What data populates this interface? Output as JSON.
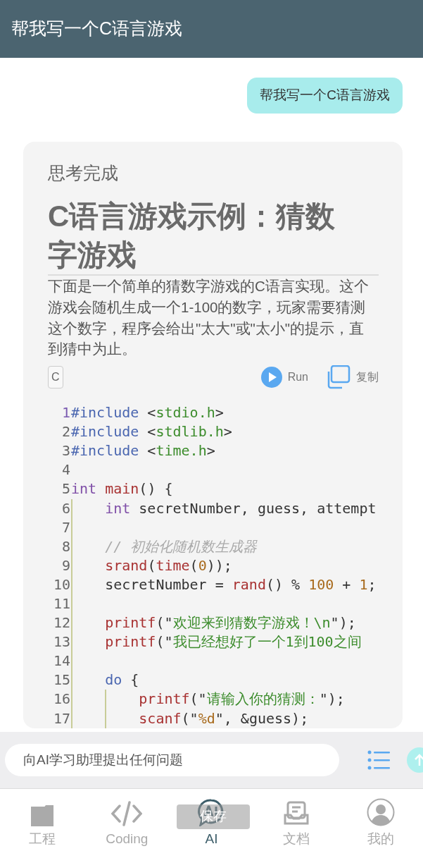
{
  "header": {
    "title": "帮我写一个C语言游戏"
  },
  "user_message": "帮我写一个C语言游戏",
  "answer": {
    "status": "思考完成",
    "heading": "C语言游戏示例：猜数字游戏",
    "paragraph": "下面是一个简单的猜数字游戏的C语言实现。这个游戏会随机生成一个1-100的数字，玩家需要猜测这个数字，程序会给出\"太大\"或\"太小\"的提示，直到猜中为止。",
    "code_block": {
      "language": "C",
      "run_label": "Run",
      "copy_label": "复制",
      "lines": [
        {
          "number": "1",
          "tokens": [
            {
              "kind": "directive",
              "text": "#include"
            },
            {
              "kind": "plain",
              "text": " <"
            },
            {
              "kind": "string",
              "text": "stdio.h"
            },
            {
              "kind": "plain",
              "text": ">"
            }
          ]
        },
        {
          "number": "2",
          "tokens": [
            {
              "kind": "directive",
              "text": "#include"
            },
            {
              "kind": "plain",
              "text": " <"
            },
            {
              "kind": "string",
              "text": "stdlib.h"
            },
            {
              "kind": "plain",
              "text": ">"
            }
          ]
        },
        {
          "number": "3",
          "tokens": [
            {
              "kind": "directive",
              "text": "#include"
            },
            {
              "kind": "plain",
              "text": " <"
            },
            {
              "kind": "string",
              "text": "time.h"
            },
            {
              "kind": "plain",
              "text": ">"
            }
          ]
        },
        {
          "number": "4"
        },
        {
          "number": "5",
          "tokens": [
            {
              "kind": "type",
              "text": "int"
            },
            {
              "kind": "function",
              "text": " main"
            },
            {
              "kind": "plain",
              "text": "() {"
            }
          ],
          "children": [
            {
              "number": "6",
              "tokens": [
                {
                  "kind": "type",
                  "text": "int"
                },
                {
                  "kind": "plain",
                  "text": " secretNumber, guess, attempt"
                }
              ]
            },
            {
              "number": "7"
            },
            {
              "number": "8",
              "tokens": [
                {
                  "kind": "comment",
                  "text": "// 初始化随机数生成器"
                }
              ]
            },
            {
              "number": "9",
              "tokens": [
                {
                  "kind": "function",
                  "text": "srand"
                },
                {
                  "kind": "plain",
                  "text": "("
                },
                {
                  "kind": "function",
                  "text": "time"
                },
                {
                  "kind": "plain",
                  "text": "("
                },
                {
                  "kind": "number",
                  "text": "0"
                },
                {
                  "kind": "plain",
                  "text": "));"
                }
              ]
            },
            {
              "number": "10",
              "tokens": [
                {
                  "kind": "plain",
                  "text": "secretNumber = "
                },
                {
                  "kind": "function",
                  "text": "rand"
                },
                {
                  "kind": "plain",
                  "text": "() % "
                },
                {
                  "kind": "number",
                  "text": "100"
                },
                {
                  "kind": "plain",
                  "text": " + "
                },
                {
                  "kind": "number",
                  "text": "1"
                },
                {
                  "kind": "plain",
                  "text": ";"
                }
              ]
            },
            {
              "number": "11"
            },
            {
              "number": "12",
              "tokens": [
                {
                  "kind": "function",
                  "text": "printf"
                },
                {
                  "kind": "plain",
                  "text": "(\""
                },
                {
                  "kind": "string",
                  "text": "欢迎来到猜数字游戏！\\n"
                },
                {
                  "kind": "plain",
                  "text": "\");"
                }
              ]
            },
            {
              "number": "13",
              "tokens": [
                {
                  "kind": "function",
                  "text": "printf"
                },
                {
                  "kind": "plain",
                  "text": "(\""
                },
                {
                  "kind": "string",
                  "text": "我已经想好了一个1到100之间"
                }
              ]
            },
            {
              "number": "14"
            },
            {
              "number": "15",
              "tokens": [
                {
                  "kind": "keyword",
                  "text": "do"
                },
                {
                  "kind": "plain",
                  "text": " {"
                }
              ],
              "children": [
                {
                  "number": "16",
                  "tokens": [
                    {
                      "kind": "function",
                      "text": "printf"
                    },
                    {
                      "kind": "plain",
                      "text": "(\""
                    },
                    {
                      "kind": "string",
                      "text": "请输入你的猜测："
                    },
                    {
                      "kind": "plain",
                      "text": "\");"
                    }
                  ]
                },
                {
                  "number": "17",
                  "tokens": [
                    {
                      "kind": "function",
                      "text": "scanf"
                    },
                    {
                      "kind": "plain",
                      "text": "(\""
                    },
                    {
                      "kind": "number",
                      "text": "%d"
                    },
                    {
                      "kind": "plain",
                      "text": "\", &guess);"
                    }
                  ]
                }
              ]
            }
          ]
        }
      ]
    }
  },
  "composer": {
    "placeholder": "向AI学习助理提出任何问题"
  },
  "nav": [
    {
      "kind": "folder",
      "label": "工程",
      "selected": false
    },
    {
      "kind": "code",
      "label": "Coding",
      "selected": false
    },
    {
      "kind": "ai",
      "label": "AI",
      "selected": true
    },
    {
      "kind": "document",
      "label": "文档",
      "selected": false
    },
    {
      "kind": "profile",
      "label": "我的",
      "selected": false
    }
  ],
  "toast": "保存"
}
